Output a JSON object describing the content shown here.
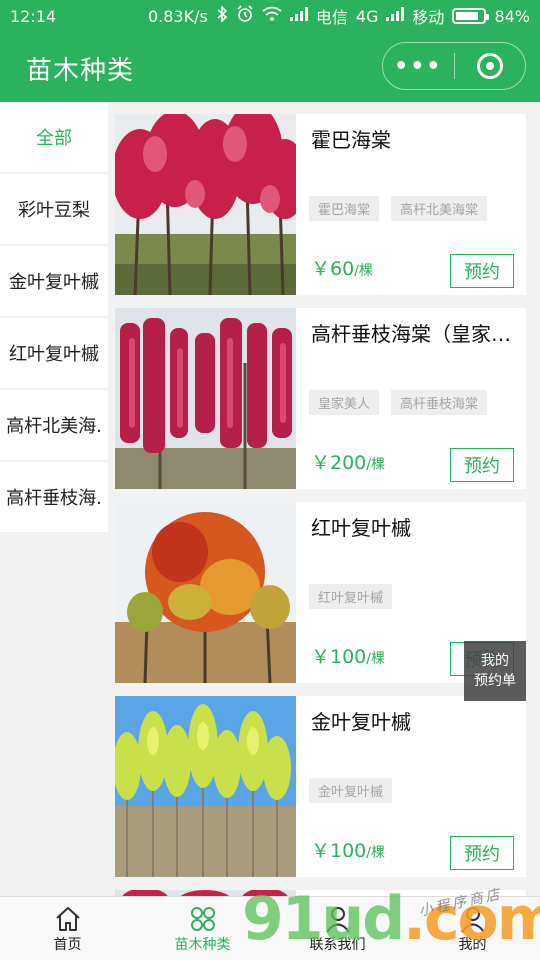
{
  "status_bar": {
    "time": "12:14",
    "network_speed": "0.83K/s",
    "carrier1": "电信",
    "carrier1_net": "4G",
    "carrier2": "移动",
    "battery": "84%",
    "battery_level": 0.84
  },
  "header": {
    "title": "苗木种类",
    "more_glyph": "•••"
  },
  "sidebar": {
    "items": [
      {
        "label": "全部",
        "active": true
      },
      {
        "label": "彩叶豆梨"
      },
      {
        "label": "金叶复叶槭"
      },
      {
        "label": "红叶复叶槭"
      },
      {
        "label": "高杆北美海."
      },
      {
        "label": "高杆垂枝海."
      }
    ]
  },
  "products": [
    {
      "name": "霍巴海棠",
      "tags": [
        "霍巴海棠",
        "高杆北美海棠"
      ],
      "price": "￥60",
      "unit": "/棵",
      "button": "预约"
    },
    {
      "name": "高杆垂枝海棠（皇家美人）",
      "tags": [
        "皇家美人",
        "高杆垂枝海棠"
      ],
      "price": "￥200",
      "unit": "/棵",
      "button": "预约"
    },
    {
      "name": "红叶复叶槭",
      "tags": [
        "红叶复叶槭"
      ],
      "price": "￥100",
      "unit": "/棵",
      "button": "预约"
    },
    {
      "name": "金叶复叶槭",
      "tags": [
        "金叶复叶槭"
      ],
      "price": "￥100",
      "unit": "/棵",
      "button": "预约"
    }
  ],
  "floating_button": {
    "line1": "我的",
    "line2": "预约单"
  },
  "tabbar": {
    "items": [
      {
        "label": "首页",
        "icon": "home-icon"
      },
      {
        "label": "苗木种类",
        "icon": "grid-icon",
        "active": true
      },
      {
        "label": "联系我们",
        "icon": "contact-icon"
      },
      {
        "label": "我的",
        "icon": "user-icon"
      }
    ]
  },
  "watermark": {
    "brand_green": "91ud",
    "brand_orange": ".com",
    "tagline": "小程序商店"
  },
  "colors": {
    "accent": "#2bb25e",
    "tag_bg": "#eeeeee",
    "tag_text": "#a5a5a5"
  }
}
